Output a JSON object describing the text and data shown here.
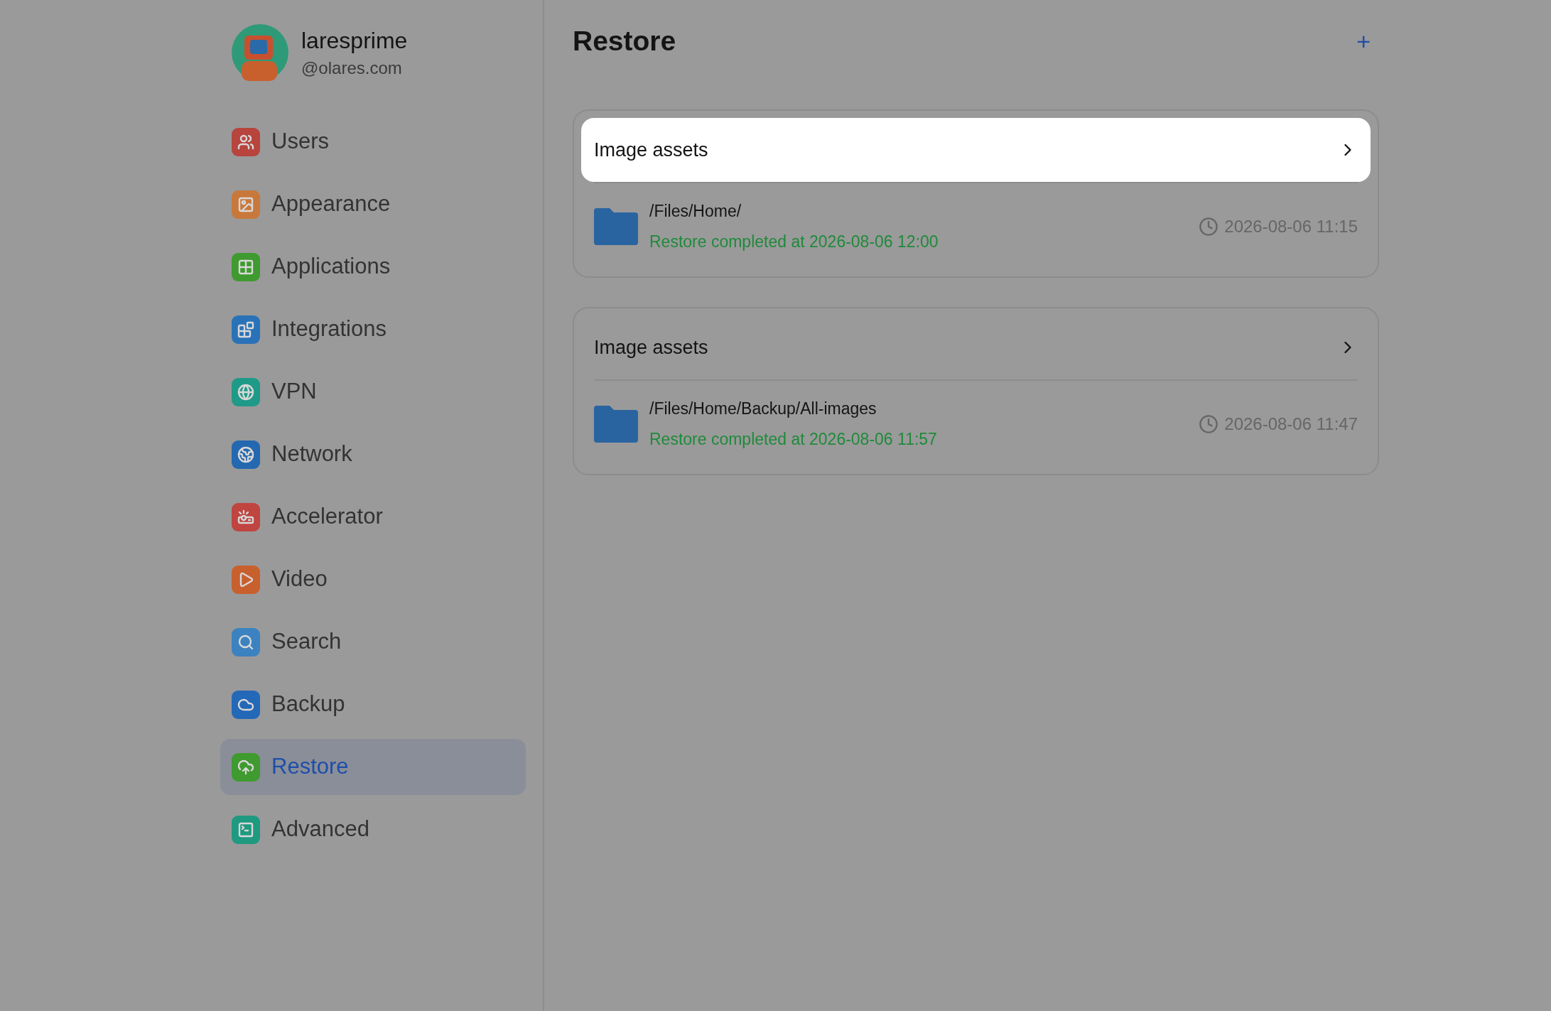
{
  "profile": {
    "name": "laresprime",
    "domain": "@olares.com"
  },
  "sidebar": {
    "items": [
      {
        "kind": "users",
        "label": "Users",
        "color": "#b8443e",
        "selected": false
      },
      {
        "kind": "appearance",
        "label": "Appearance",
        "color": "#c8783a",
        "selected": false
      },
      {
        "kind": "applications",
        "label": "Applications",
        "color": "#3f9a2f",
        "selected": false
      },
      {
        "kind": "integrations",
        "label": "Integrations",
        "color": "#2a72b8",
        "selected": false
      },
      {
        "kind": "vpn",
        "label": "VPN",
        "color": "#1f9a88",
        "selected": false
      },
      {
        "kind": "network",
        "label": "Network",
        "color": "#2468b0",
        "selected": false
      },
      {
        "kind": "accelerator",
        "label": "Accelerator",
        "color": "#c04440",
        "selected": false
      },
      {
        "kind": "video",
        "label": "Video",
        "color": "#c8602e",
        "selected": false
      },
      {
        "kind": "search",
        "label": "Search",
        "color": "#3c82c0",
        "selected": false
      },
      {
        "kind": "backup",
        "label": "Backup",
        "color": "#2468b8",
        "selected": false
      },
      {
        "kind": "restore",
        "label": "Restore",
        "color": "#3f9a2f",
        "selected": true
      },
      {
        "kind": "advanced",
        "label": "Advanced",
        "color": "#1f9a80",
        "selected": false
      }
    ]
  },
  "page": {
    "title": "Restore",
    "add_button": "+"
  },
  "cards": [
    {
      "title": "Image assets",
      "highlighted": true,
      "path": "/Files/Home/",
      "status": "Restore completed at 2026-08-06 12:00",
      "time": "2026-08-06 11:15"
    },
    {
      "title": "Image assets",
      "highlighted": false,
      "path": "/Files/Home/Backup/All-images",
      "status": "Restore completed at 2026-08-06 11:57",
      "time": "2026-08-06 11:47"
    }
  ]
}
